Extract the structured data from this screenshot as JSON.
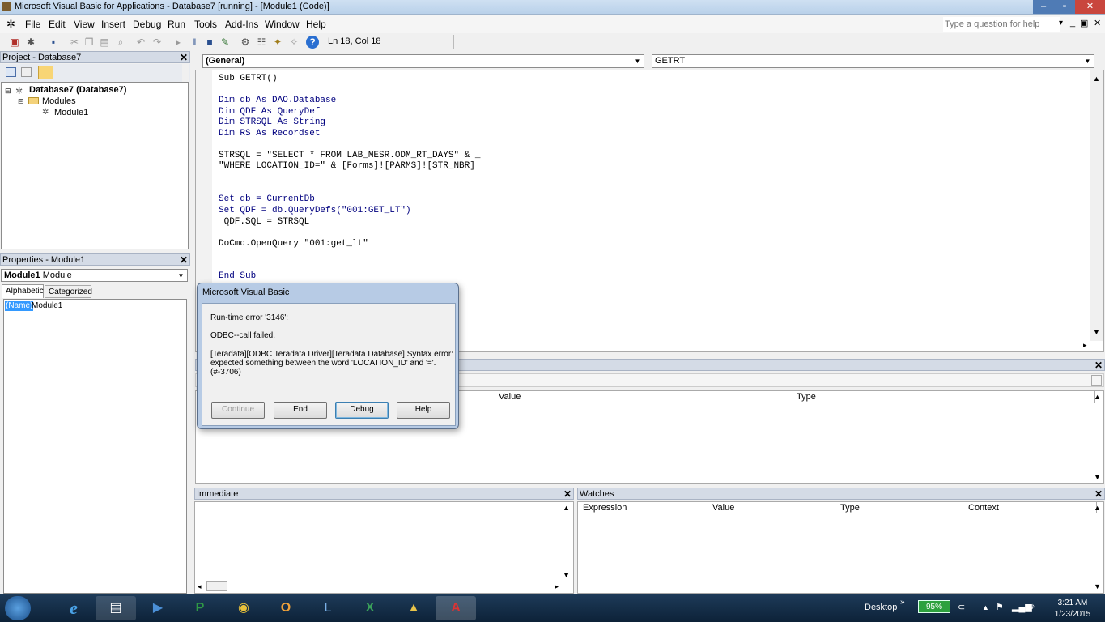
{
  "window": {
    "title": "Microsoft Visual Basic for Applications - Database7 [running] - [Module1 (Code)]"
  },
  "menu": [
    "File",
    "Edit",
    "View",
    "Insert",
    "Debug",
    "Run",
    "Tools",
    "Add-Ins",
    "Window",
    "Help"
  ],
  "help_box": {
    "placeholder": "Type a question for help"
  },
  "toolbar": {
    "position": "Ln 18, Col 18"
  },
  "project": {
    "header": "Project - Database7",
    "root": "Database7 (Database7)",
    "folder": "Modules",
    "module": "Module1"
  },
  "properties": {
    "header": "Properties - Module1",
    "object_name": "Module1",
    "object_type": "Module",
    "tab_alphabetic": "Alphabetic",
    "tab_categorized": "Categorized",
    "prop_name": "(Name)",
    "prop_value": "Module1"
  },
  "code": {
    "object_combo": "(General)",
    "proc_combo": "GETRT",
    "lines": [
      "Sub GETRT()",
      "",
      "Dim db As DAO.Database",
      "Dim QDF As QueryDef",
      "Dim STRSQL As String",
      "Dim RS As Recordset",
      "",
      "STRSQL = \"SELECT * FROM LAB_MESR.ODM_RT_DAYS\" & _",
      "\"WHERE LOCATION_ID=\" & [Forms]![PARMS]![STR_NBR]",
      "",
      "",
      "Set db = CurrentDb",
      "Set QDF = db.QueryDefs(\"001:GET_LT\")",
      " QDF.SQL = STRSQL",
      "",
      "DoCmd.OpenQuery \"001:get_lt\"",
      "",
      "",
      "End Sub"
    ]
  },
  "locals": {
    "col_value": "Value",
    "col_type": "Type"
  },
  "immediate": {
    "header": "Immediate"
  },
  "watches": {
    "header": "Watches",
    "col_expression": "Expression",
    "col_value": "Value",
    "col_type": "Type",
    "col_context": "Context"
  },
  "dialog": {
    "title": "Microsoft Visual Basic",
    "line1": "Run-time error '3146':",
    "line2": "ODBC--call failed.",
    "line3": "[Teradata][ODBC Teradata Driver][Teradata Database] Syntax error: expected something between the word 'LOCATION_ID' and '='. (#-3706)",
    "btn_continue": "Continue",
    "btn_end": "End",
    "btn_debug": "Debug",
    "btn_help": "Help"
  },
  "taskbar": {
    "desktop": "Desktop",
    "battery": "95%",
    "time": "3:21 AM",
    "date": "1/23/2015"
  }
}
